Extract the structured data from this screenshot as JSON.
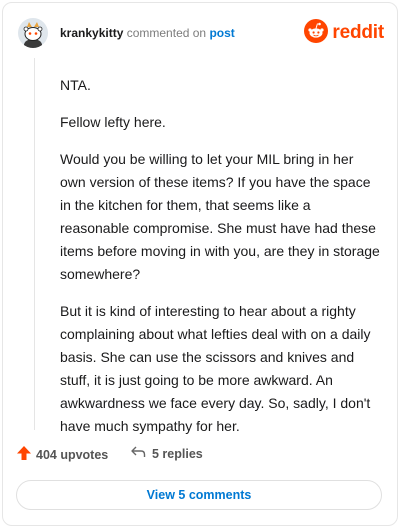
{
  "header": {
    "username": "krankykitty",
    "action_text": "commented on",
    "post_link": "post",
    "brand": "reddit",
    "avatar_icon": "snoo-avatar-icon",
    "logo_icon": "reddit-alien-icon"
  },
  "comment": {
    "paragraphs": [
      "NTA.",
      "Fellow lefty here.",
      "Would you be willing to let your MIL bring in her own version of these items? If you have the space in the kitchen for them, that seems like a reasonable compromise. She must have had these items before moving in with you, are they in storage somewhere?",
      "But it is kind of interesting to hear about a righty complaining about what lefties deal with on a daily basis. She can use the scissors and knives and stuff, it is just going to be more awkward. An awkwardness we face every day. So, sadly, I don't have much sympathy for her."
    ]
  },
  "footer": {
    "upvotes": "404 upvotes",
    "replies": "5 replies",
    "view_comments": "View 5 comments",
    "upvote_icon": "upvote-arrow-icon",
    "reply_icon": "reply-arrow-icon"
  },
  "colors": {
    "brand_orange": "#ff4500",
    "link_blue": "#0079d3"
  }
}
